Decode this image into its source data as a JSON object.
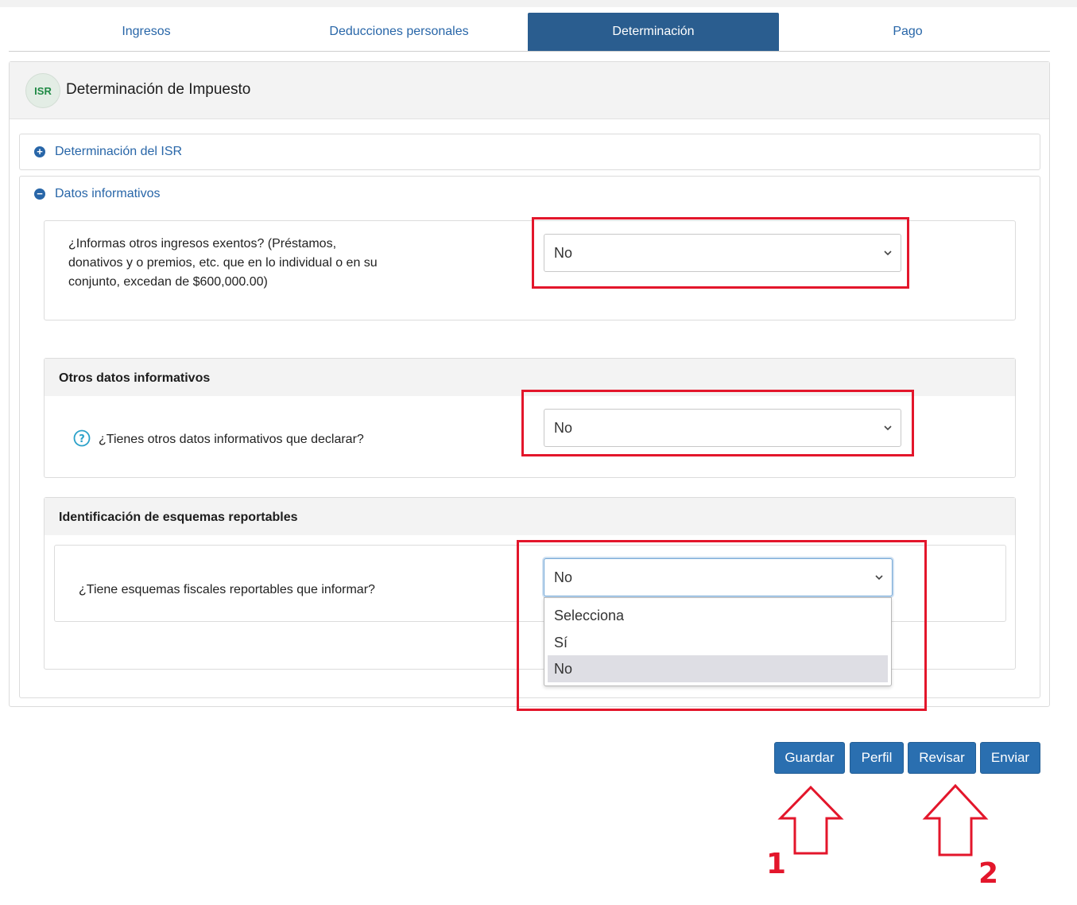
{
  "tabs": [
    {
      "label": "Ingresos"
    },
    {
      "label": "Deducciones personales"
    },
    {
      "label": "Determinación"
    },
    {
      "label": "Pago"
    }
  ],
  "panel": {
    "badge": "ISR",
    "title": "Determinación de Impuesto"
  },
  "sections": {
    "determinacion": {
      "title": "Determinación del ISR",
      "icon": "plus-circle-icon"
    },
    "datos": {
      "title": "Datos informativos",
      "icon": "minus-circle-icon"
    }
  },
  "questions": {
    "q1": {
      "line1": "¿Informas otros ingresos exentos? (Préstamos,",
      "line2": "donativos y o premios, etc. que en lo individual o en su",
      "line3": "conjunto, excedan de $600,000.00)",
      "value": "No"
    },
    "otros": {
      "heading": "Otros datos informativos",
      "text": "¿Tienes otros datos informativos que declarar?",
      "value": "No",
      "help_icon": "question-circle-icon"
    },
    "esquemas": {
      "heading": "Identificación de esquemas reportables",
      "text": "¿Tiene esquemas fiscales reportables que informar?",
      "value": "No",
      "options": [
        "Selecciona",
        "Sí",
        "No"
      ]
    }
  },
  "buttons": {
    "guardar": "Guardar",
    "perfil": "Perfil",
    "revisar": "Revisar",
    "enviar": "Enviar"
  },
  "annotations": {
    "num1": "1",
    "num2": "2",
    "accent": "#e3162b"
  },
  "colors": {
    "tab_active": "#2a5d8f",
    "link": "#2866a8",
    "button": "#2a6fb0"
  }
}
